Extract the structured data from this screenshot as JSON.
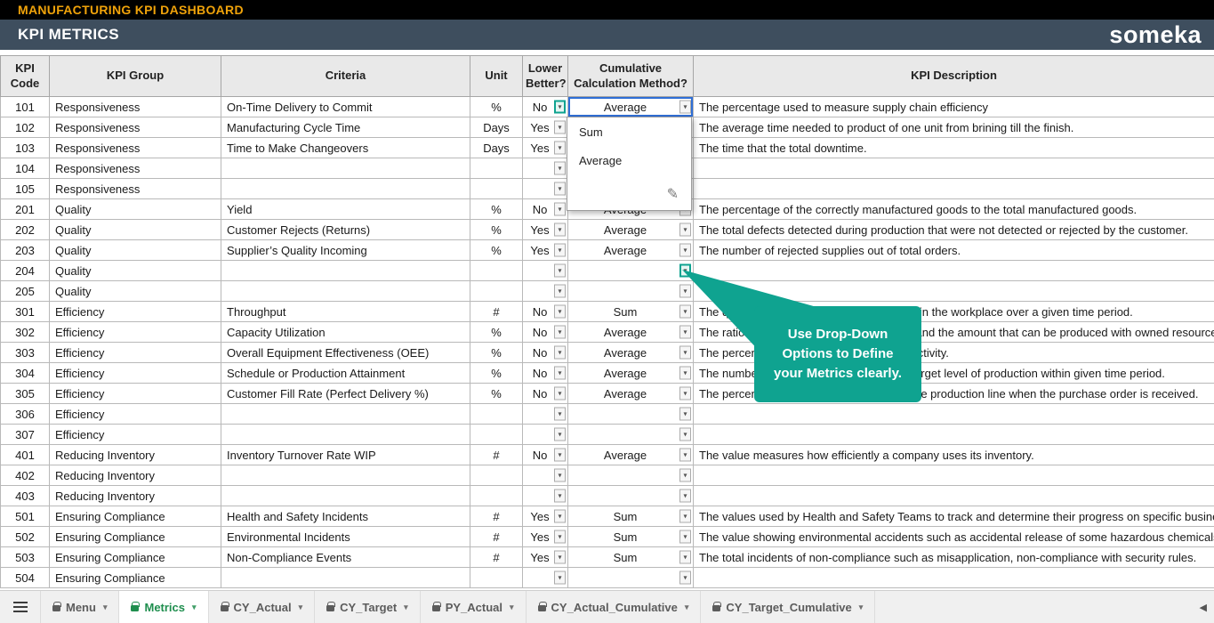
{
  "colors": {
    "accent": "#0fa390",
    "title": "#f0a30a",
    "headerBg": "#3e4e5e",
    "tabGreen": "#1f8e4e",
    "selBlue": "#2f6fd6"
  },
  "title_bar": {
    "title": "MANUFACTURING KPI DASHBOARD"
  },
  "header": {
    "title": "KPI METRICS",
    "brand": "someka"
  },
  "icons": {
    "dropdown_arrow": "▾",
    "caret_down": "▾",
    "pencil": "✎",
    "scroll_left": "◀"
  },
  "dropdown": {
    "options": [
      "Sum",
      "Average"
    ]
  },
  "callout": {
    "text": "Use Drop-Down Options to Define your Metrics clearly."
  },
  "table": {
    "columns": [
      "KPI Code",
      "KPI Group",
      "Criteria",
      "Unit",
      "Lower Better?",
      "Cumulative Calculation Method?",
      "KPI Description"
    ],
    "rows": [
      {
        "code": "101",
        "group": "Responsiveness",
        "criteria": "On-Time Delivery to Commit",
        "unit": "%",
        "lower": "No",
        "method": "Average",
        "desc": "The percentage used to measure supply chain efficiency",
        "hl_lower": true,
        "sel_method": true
      },
      {
        "code": "102",
        "group": "Responsiveness",
        "criteria": "Manufacturing Cycle Time",
        "unit": "Days",
        "lower": "Yes",
        "method": "",
        "desc": "The average time needed to product of one unit from brining till the finish."
      },
      {
        "code": "103",
        "group": "Responsiveness",
        "criteria": "Time to Make Changeovers",
        "unit": "Days",
        "lower": "Yes",
        "method": "",
        "desc": "The time that the total downtime."
      },
      {
        "code": "104",
        "group": "Responsiveness",
        "criteria": "",
        "unit": "",
        "lower": "",
        "method": "",
        "desc": ""
      },
      {
        "code": "105",
        "group": "Responsiveness",
        "criteria": "",
        "unit": "",
        "lower": "",
        "method": "",
        "desc": ""
      },
      {
        "code": "201",
        "group": "Quality",
        "criteria": "Yield",
        "unit": "%",
        "lower": "No",
        "method": "Average",
        "desc": "The percentage of the correctly manufactured goods to the total manufactured goods."
      },
      {
        "code": "202",
        "group": "Quality",
        "criteria": "Customer Rejects (Returns)",
        "unit": "%",
        "lower": "Yes",
        "method": "Average",
        "desc": "The total defects detected during production that were not detected or rejected by the customer."
      },
      {
        "code": "203",
        "group": "Quality",
        "criteria": "Supplier’s Quality Incoming",
        "unit": "%",
        "lower": "Yes",
        "method": "Average",
        "desc": "The number of rejected supplies out of total orders."
      },
      {
        "code": "204",
        "group": "Quality",
        "criteria": "",
        "unit": "",
        "lower": "",
        "method": "",
        "desc": "",
        "hl_method": true
      },
      {
        "code": "205",
        "group": "Quality",
        "criteria": "",
        "unit": "",
        "lower": "",
        "method": "",
        "desc": ""
      },
      {
        "code": "301",
        "group": "Efficiency",
        "criteria": "Throughput",
        "unit": "#",
        "lower": "No",
        "method": "Sum",
        "desc": "The quantity of the products manufactured in the workplace over a given time period."
      },
      {
        "code": "302",
        "group": "Efficiency",
        "criteria": "Capacity Utilization",
        "unit": "%",
        "lower": "No",
        "method": "Average",
        "desc": "The ratio between actual output produced and the amount that can be produced with owned resources."
      },
      {
        "code": "303",
        "group": "Efficiency",
        "criteria": "Overall Equipment Effectiveness (OEE)",
        "unit": "%",
        "lower": "No",
        "method": "Average",
        "desc": "The percentage showing the level of productivity."
      },
      {
        "code": "304",
        "group": "Efficiency",
        "criteria": "Schedule or Production Attainment",
        "unit": "%",
        "lower": "No",
        "method": "Average",
        "desc": "The number showing the achievement of target level of production within given time period."
      },
      {
        "code": "305",
        "group": "Efficiency",
        "criteria": "Customer Fill Rate (Perfect Delivery %)",
        "unit": "%",
        "lower": "No",
        "method": "Average",
        "desc": "The percentage of materials available on the production line when the purchase order is received."
      },
      {
        "code": "306",
        "group": "Efficiency",
        "criteria": "",
        "unit": "",
        "lower": "",
        "method": "",
        "desc": ""
      },
      {
        "code": "307",
        "group": "Efficiency",
        "criteria": "",
        "unit": "",
        "lower": "",
        "method": "",
        "desc": ""
      },
      {
        "code": "401",
        "group": "Reducing Inventory",
        "criteria": "Inventory Turnover Rate WIP",
        "unit": "#",
        "lower": "No",
        "method": "Average",
        "desc": "The value measures how efficiently a company uses its inventory."
      },
      {
        "code": "402",
        "group": "Reducing Inventory",
        "criteria": "",
        "unit": "",
        "lower": "",
        "method": "",
        "desc": ""
      },
      {
        "code": "403",
        "group": "Reducing Inventory",
        "criteria": "",
        "unit": "",
        "lower": "",
        "method": "",
        "desc": ""
      },
      {
        "code": "501",
        "group": "Ensuring Compliance",
        "criteria": "Health and Safety Incidents",
        "unit": "#",
        "lower": "Yes",
        "method": "Sum",
        "desc": "The values used by Health and Safety Teams to track and determine their progress on specific business goals."
      },
      {
        "code": "502",
        "group": "Ensuring Compliance",
        "criteria": "Environmental Incidents",
        "unit": "#",
        "lower": "Yes",
        "method": "Sum",
        "desc": "The value showing environmental accidents such as accidental release of some hazardous chemicals."
      },
      {
        "code": "503",
        "group": "Ensuring Compliance",
        "criteria": "Non-Compliance Events",
        "unit": "#",
        "lower": "Yes",
        "method": "Sum",
        "desc": "The total incidents of non-compliance such as misapplication, non-compliance with security rules."
      },
      {
        "code": "504",
        "group": "Ensuring Compliance",
        "criteria": "",
        "unit": "",
        "lower": "",
        "method": "",
        "desc": ""
      }
    ]
  },
  "tabs": [
    {
      "label": "Menu"
    },
    {
      "label": "Metrics",
      "active": true
    },
    {
      "label": "CY_Actual"
    },
    {
      "label": "CY_Target"
    },
    {
      "label": "PY_Actual"
    },
    {
      "label": "CY_Actual_Cumulative"
    },
    {
      "label": "CY_Target_Cumulative"
    }
  ]
}
